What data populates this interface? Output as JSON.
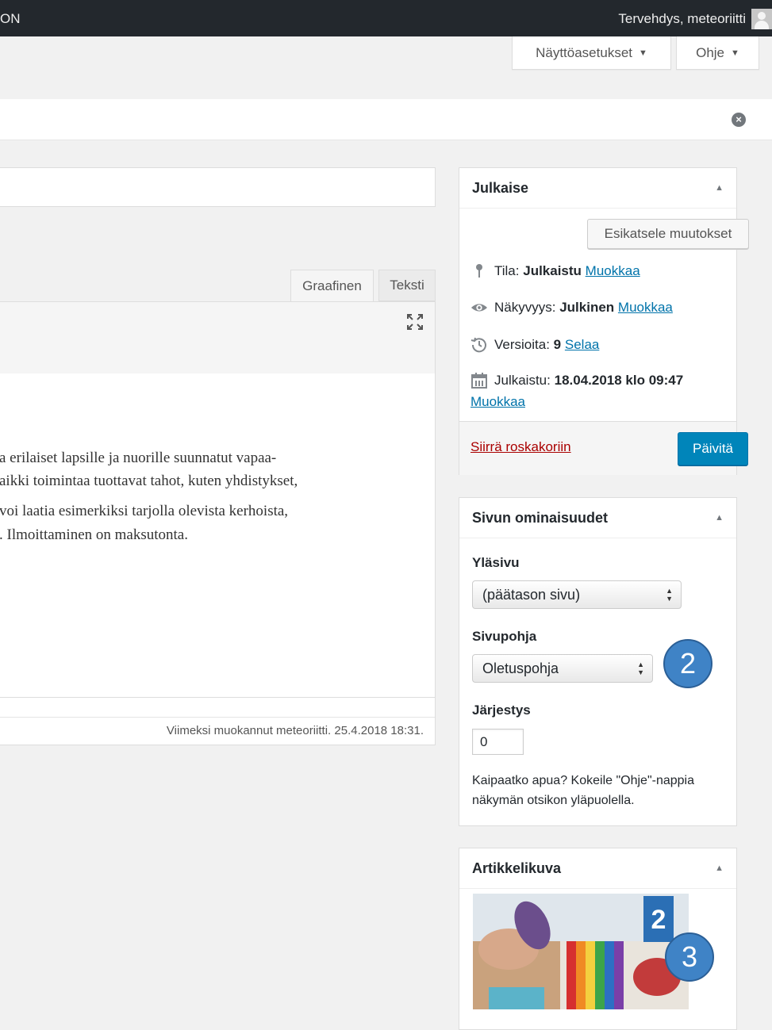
{
  "adminbar": {
    "site_fragment": "ON",
    "greeting": "Tervehdys, meteoriitti"
  },
  "screen_tabs": {
    "screen_options": "Näyttöasetukset",
    "help": "Ohje",
    "arrow": "▼"
  },
  "notice": {
    "dismiss": "×"
  },
  "editor": {
    "tab_visual": "Graafinen",
    "tab_text": "Teksti",
    "lines": [
      "a erilaiset lapsille ja nuorille suunnatut vapaa-",
      "aikki toimintaa tuottavat tahot, kuten yhdistykset,",
      " voi laatia esimerkiksi tarjolla olevista kerhoista,",
      ". Ilmoittaminen on maksutonta."
    ],
    "last_edited": "Viimeksi muokannut meteoriitti. 25.4.2018 18:31."
  },
  "publish_box": {
    "title": "Julkaise",
    "toggle": "▲",
    "preview_button": "Esikatsele muutokset",
    "status_label": "Tila:",
    "status_value": "Julkaistu",
    "status_edit": "Muokkaa",
    "visibility_label": "Näkyvyys:",
    "visibility_value": "Julkinen",
    "visibility_edit": "Muokkaa",
    "revisions_label": "Versioita:",
    "revisions_value": "9",
    "revisions_browse": "Selaa",
    "published_label": "Julkaistu:",
    "published_value": "18.04.2018 klo 09:47",
    "published_edit": "Muokkaa",
    "trash_link": "Siirrä roskakoriin",
    "update_button": "Päivitä"
  },
  "page_attributes": {
    "title": "Sivun ominaisuudet",
    "toggle": "▲",
    "parent_label": "Yläsivu",
    "parent_value": "(päätason sivu)",
    "template_label": "Sivupohja",
    "template_value": "Oletuspohja",
    "order_label": "Järjestys",
    "order_value": "0",
    "help_text": "Kaipaatko apua? Kokeile \"Ohje\"-nappia näkymän otsikon yläpuolella."
  },
  "featured_image": {
    "title": "Artikkelikuva",
    "toggle": "▲",
    "cup_label": "2"
  },
  "callouts": {
    "first": "2",
    "second": "3"
  },
  "colors": {
    "adminbar": "#23282d",
    "link": "#0073aa",
    "primary_button": "#0085ba",
    "trash": "#a00000",
    "callout": "#3f83c6"
  },
  "icons": {
    "status": "pin-icon",
    "visibility": "eye-icon",
    "revisions": "history-icon",
    "published": "calendar-icon",
    "fullscreen": "fullscreen-icon",
    "avatar": "avatar-icon",
    "dismiss": "dismiss-icon"
  }
}
